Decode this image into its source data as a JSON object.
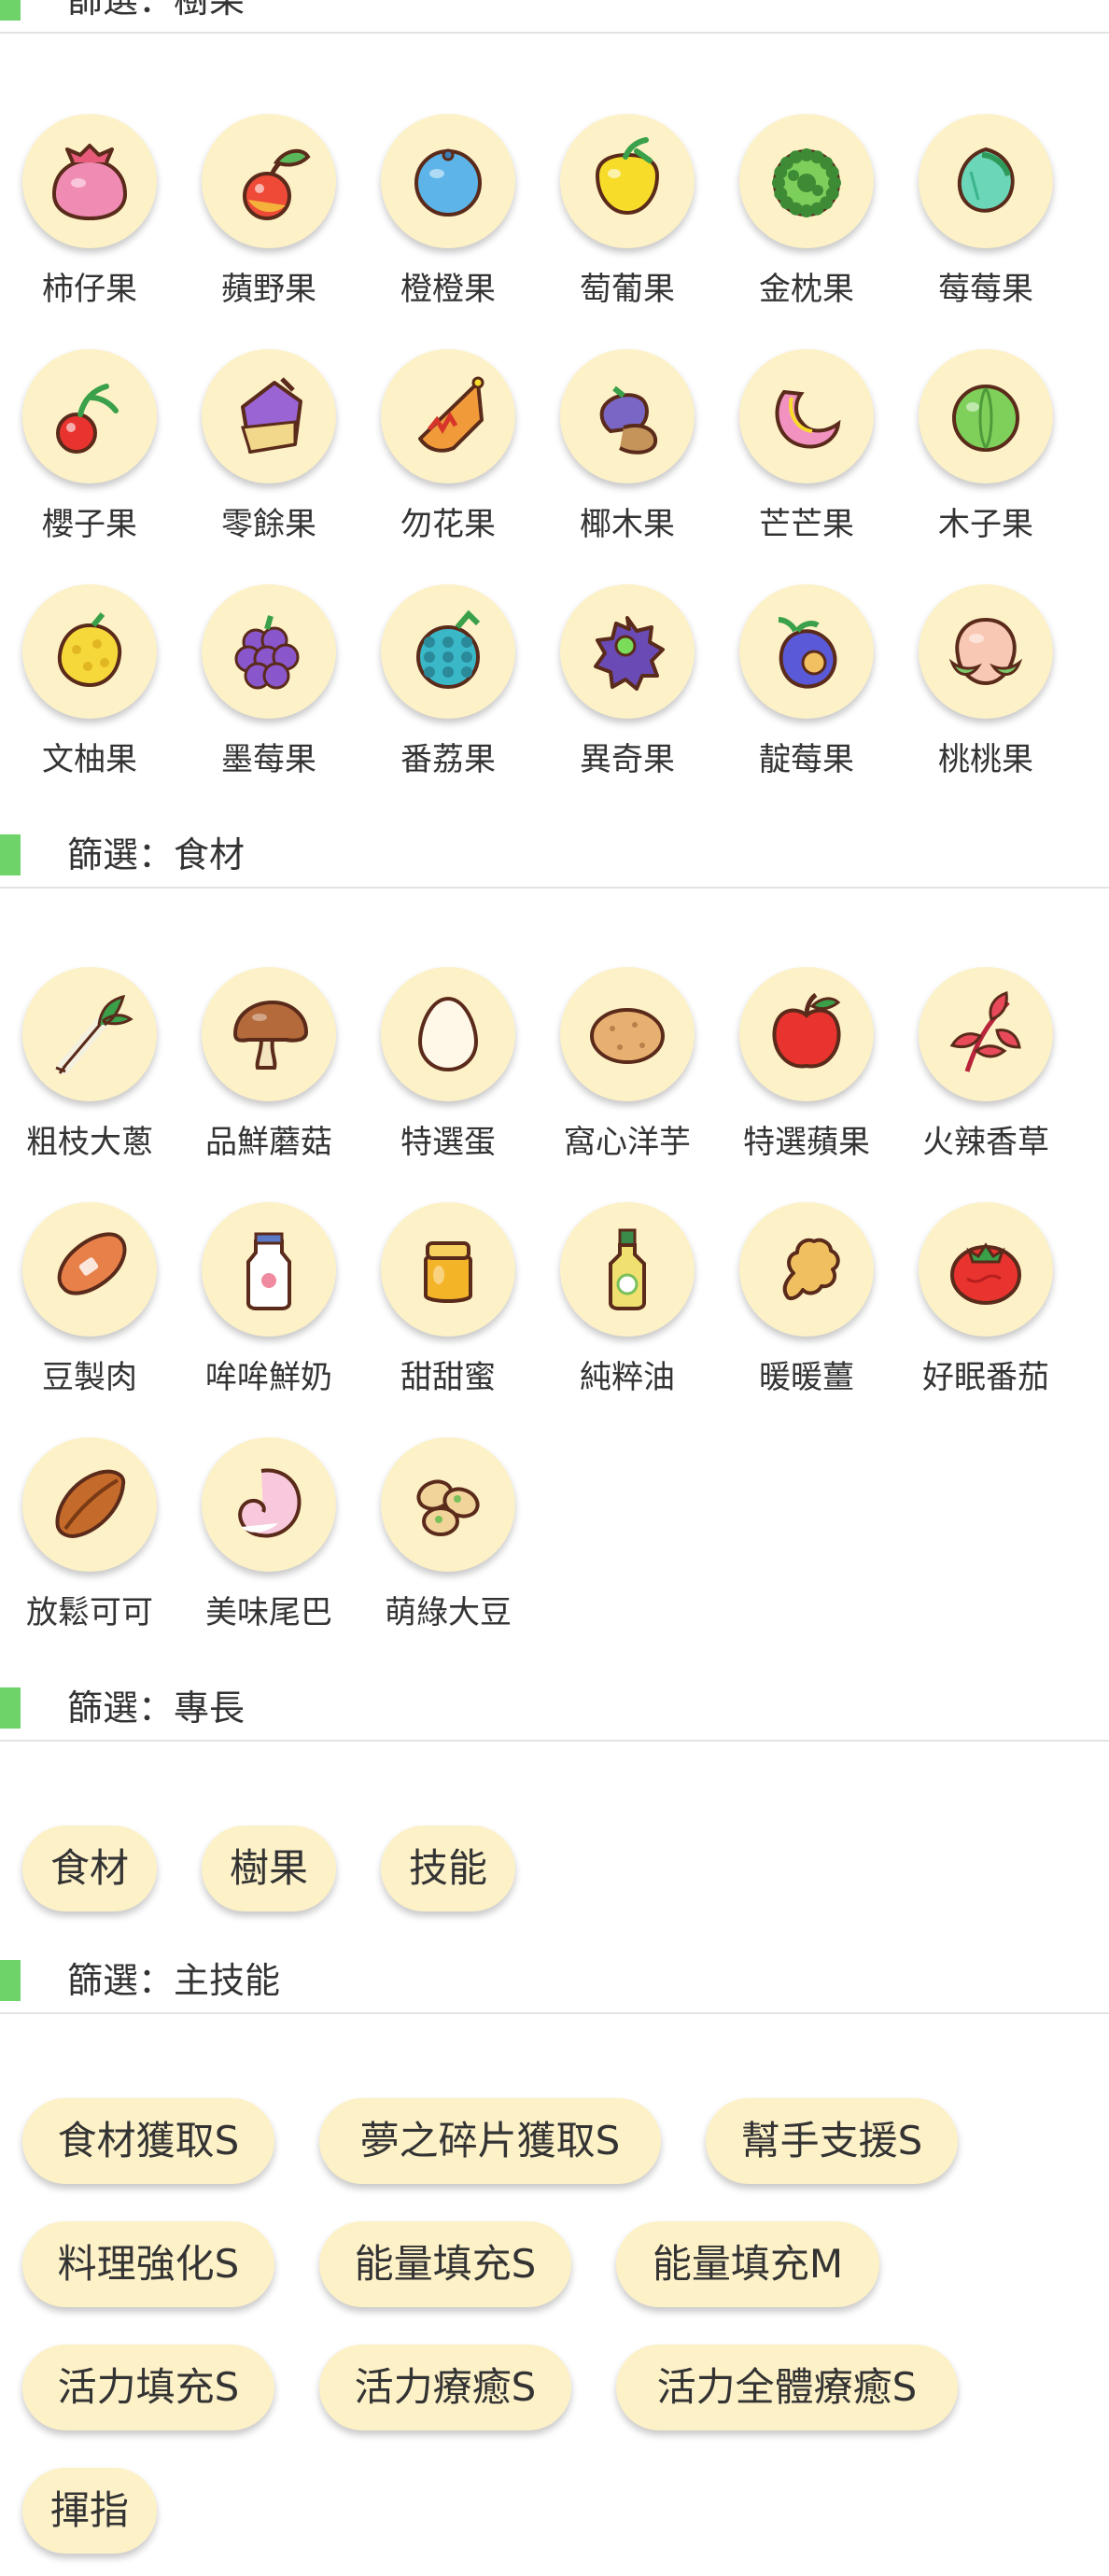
{
  "sections": {
    "berry": {
      "title": "篩選：樹果"
    },
    "ingredient": {
      "title": "篩選：食材"
    },
    "specialty": {
      "title": "篩選：專長"
    },
    "skill": {
      "title": "篩選：主技能"
    }
  },
  "berries": [
    {
      "label": "柿仔果",
      "icon": "persim-berry-icon"
    },
    {
      "label": "蘋野果",
      "icon": "cheri-berry-icon"
    },
    {
      "label": "橙橙果",
      "icon": "oran-berry-icon"
    },
    {
      "label": "萄葡果",
      "icon": "grepa-berry-icon"
    },
    {
      "label": "金枕果",
      "icon": "durin-berry-icon"
    },
    {
      "label": "莓莓果",
      "icon": "rawst-berry-icon"
    },
    {
      "label": "櫻子果",
      "icon": "cherry-berry-icon"
    },
    {
      "label": "零餘果",
      "icon": "leppa-berry-icon"
    },
    {
      "label": "勿花果",
      "icon": "figy-berry-icon"
    },
    {
      "label": "椰木果",
      "icon": "pamtre-berry-icon"
    },
    {
      "label": "芒芒果",
      "icon": "mago-berry-icon"
    },
    {
      "label": "木子果",
      "icon": "lum-berry-icon"
    },
    {
      "label": "文柚果",
      "icon": "sitrus-berry-icon"
    },
    {
      "label": "墨莓果",
      "icon": "blukberry-icon"
    },
    {
      "label": "番荔果",
      "icon": "rindo-berry-icon"
    },
    {
      "label": "異奇果",
      "icon": "wiki-berry-icon"
    },
    {
      "label": "靛莓果",
      "icon": "yache-berry-icon"
    },
    {
      "label": "桃桃果",
      "icon": "pecha-berry-icon"
    }
  ],
  "ingredients": [
    {
      "label": "粗枝大蔥",
      "icon": "leek-icon"
    },
    {
      "label": "品鮮蘑菇",
      "icon": "mushroom-icon"
    },
    {
      "label": "特選蛋",
      "icon": "egg-icon"
    },
    {
      "label": "窩心洋芋",
      "icon": "potato-icon"
    },
    {
      "label": "特選蘋果",
      "icon": "apple-icon"
    },
    {
      "label": "火辣香草",
      "icon": "herb-icon"
    },
    {
      "label": "豆製肉",
      "icon": "soy-meat-icon"
    },
    {
      "label": "哞哞鮮奶",
      "icon": "milk-bottle-icon"
    },
    {
      "label": "甜甜蜜",
      "icon": "honey-jar-icon"
    },
    {
      "label": "純粹油",
      "icon": "oil-bottle-icon"
    },
    {
      "label": "暖暖薑",
      "icon": "ginger-icon"
    },
    {
      "label": "好眠番茄",
      "icon": "tomato-icon"
    },
    {
      "label": "放鬆可可",
      "icon": "cacao-icon"
    },
    {
      "label": "美味尾巴",
      "icon": "tail-icon"
    },
    {
      "label": "萌綠大豆",
      "icon": "soybean-icon"
    }
  ],
  "specialties": [
    "食材",
    "樹果",
    "技能"
  ],
  "skills": [
    [
      "食材獲取S",
      "夢之碎片獲取S",
      "幫手支援S"
    ],
    [
      "料理強化S",
      "能量填充S",
      "能量填充M"
    ],
    [
      "活力填充S",
      "活力療癒S",
      "活力全體療癒S"
    ],
    [
      "揮指"
    ]
  ]
}
